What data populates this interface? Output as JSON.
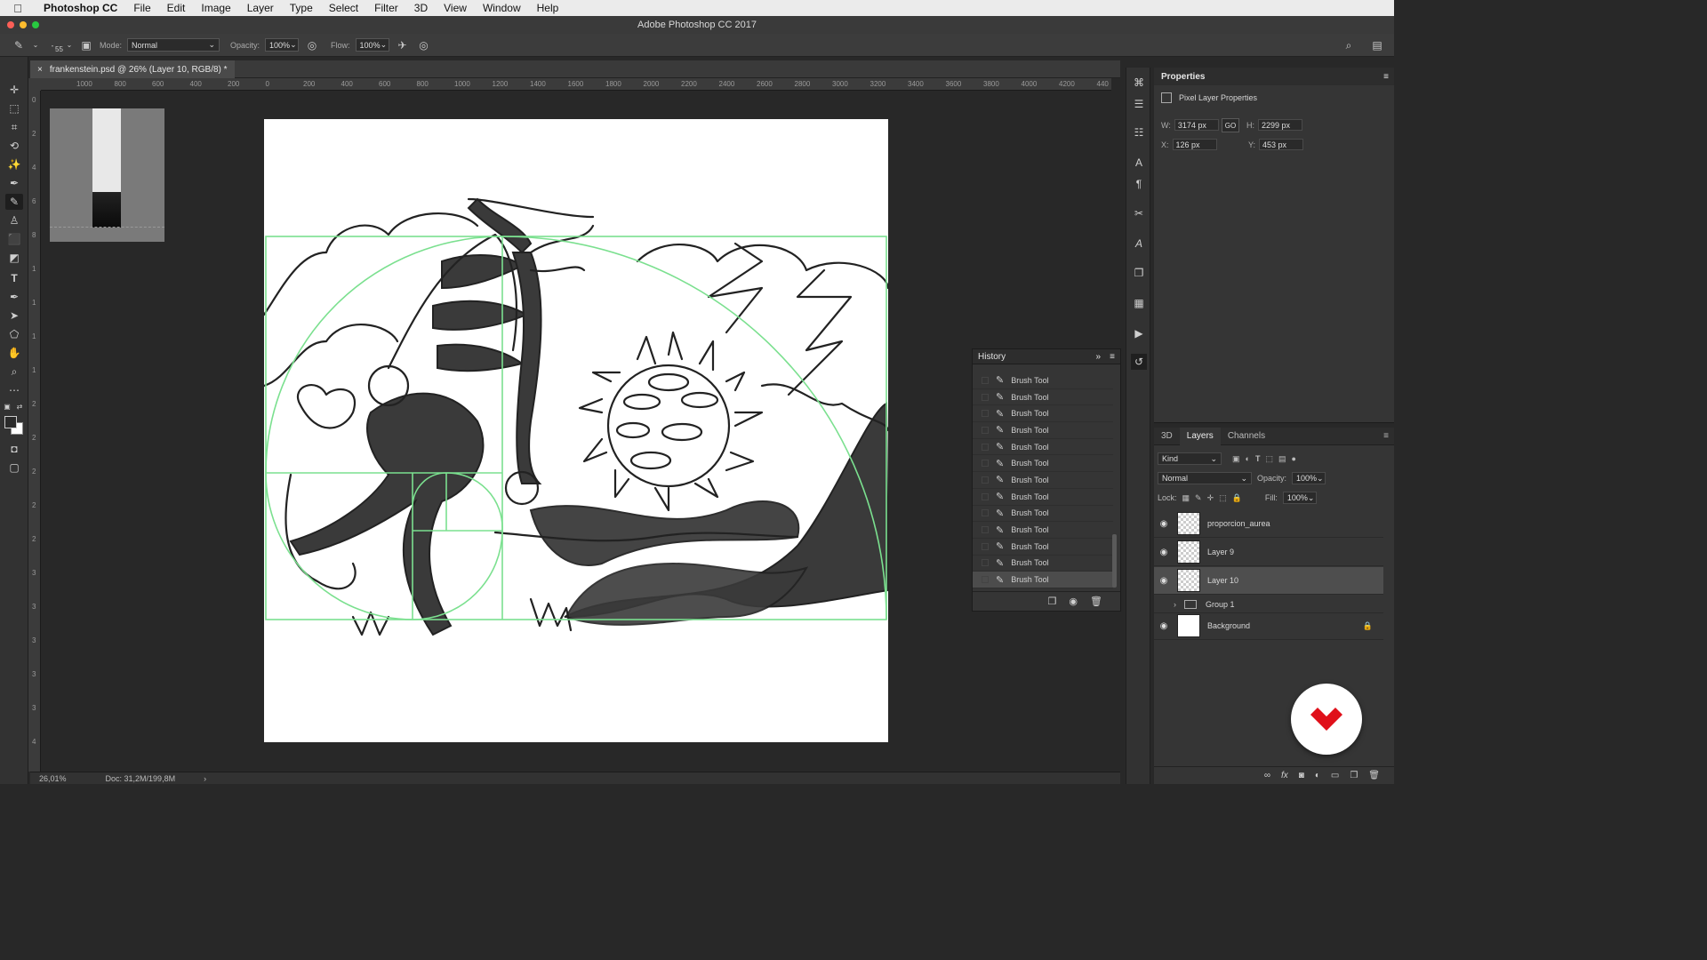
{
  "menubar": {
    "app_name": "Photoshop CC",
    "items": [
      "File",
      "Edit",
      "Image",
      "Layer",
      "Type",
      "Select",
      "Filter",
      "3D",
      "View",
      "Window",
      "Help"
    ]
  },
  "window": {
    "title": "Adobe Photoshop CC 2017"
  },
  "options_bar": {
    "brush_size": "55",
    "mode_label": "Mode:",
    "mode_value": "Normal",
    "opacity_label": "Opacity:",
    "opacity_value": "100%",
    "flow_label": "Flow:",
    "flow_value": "100%"
  },
  "document": {
    "tab_title": "frankenstein.psd @ 26% (Layer 10, RGB/8) *",
    "close_glyph": "×"
  },
  "rulers": {
    "horizontal": [
      "1000",
      "800",
      "600",
      "400",
      "200",
      "0",
      "200",
      "400",
      "600",
      "800",
      "1000",
      "1200",
      "1400",
      "1600",
      "1800",
      "2000",
      "2200",
      "2400",
      "2600",
      "2800",
      "3000",
      "3200",
      "3400",
      "3600",
      "3800",
      "4000",
      "4200",
      "440"
    ],
    "vertical": [
      "0",
      "2",
      "4",
      "6",
      "8",
      "1",
      "1",
      "1",
      "1",
      "2",
      "2",
      "2",
      "2",
      "2",
      "3",
      "3",
      "3",
      "3",
      "3",
      "4"
    ]
  },
  "status": {
    "zoom": "26,01%",
    "doc_size": "Doc: 31,2M/199,8M",
    "arrow": "›"
  },
  "history": {
    "title": "History",
    "items": [
      "Brush Tool",
      "Brush Tool",
      "Brush Tool",
      "Brush Tool",
      "Brush Tool",
      "Brush Tool",
      "Brush Tool",
      "Brush Tool",
      "Brush Tool",
      "Brush Tool",
      "Brush Tool",
      "Brush Tool",
      "Brush Tool"
    ]
  },
  "properties": {
    "title": "Properties",
    "subtitle": "Pixel Layer Properties",
    "w_label": "W:",
    "w_value": "3174 px",
    "h_label": "H:",
    "h_value": "2299 px",
    "x_label": "X:",
    "x_value": "126 px",
    "y_label": "Y:",
    "y_value": "453 px",
    "link_label": "GO"
  },
  "layers_panel": {
    "tabs": [
      "3D",
      "Layers",
      "Channels"
    ],
    "filter_kind": "Kind",
    "blend_mode": "Normal",
    "opacity_label": "Opacity:",
    "opacity_value": "100%",
    "lock_label": "Lock:",
    "fill_label": "Fill:",
    "fill_value": "100%",
    "layers": [
      {
        "name": "proporcion_aurea",
        "visible": true
      },
      {
        "name": "Layer 9",
        "visible": true
      },
      {
        "name": "Layer 10",
        "visible": true,
        "selected": true
      },
      {
        "name": "Group 1",
        "visible": false,
        "group": true
      },
      {
        "name": "Background",
        "visible": true,
        "locked": true
      }
    ]
  },
  "colors": {
    "guide_green": "#7be08f",
    "ink": "#2a2a2a",
    "badge_red": "#e0101a"
  }
}
